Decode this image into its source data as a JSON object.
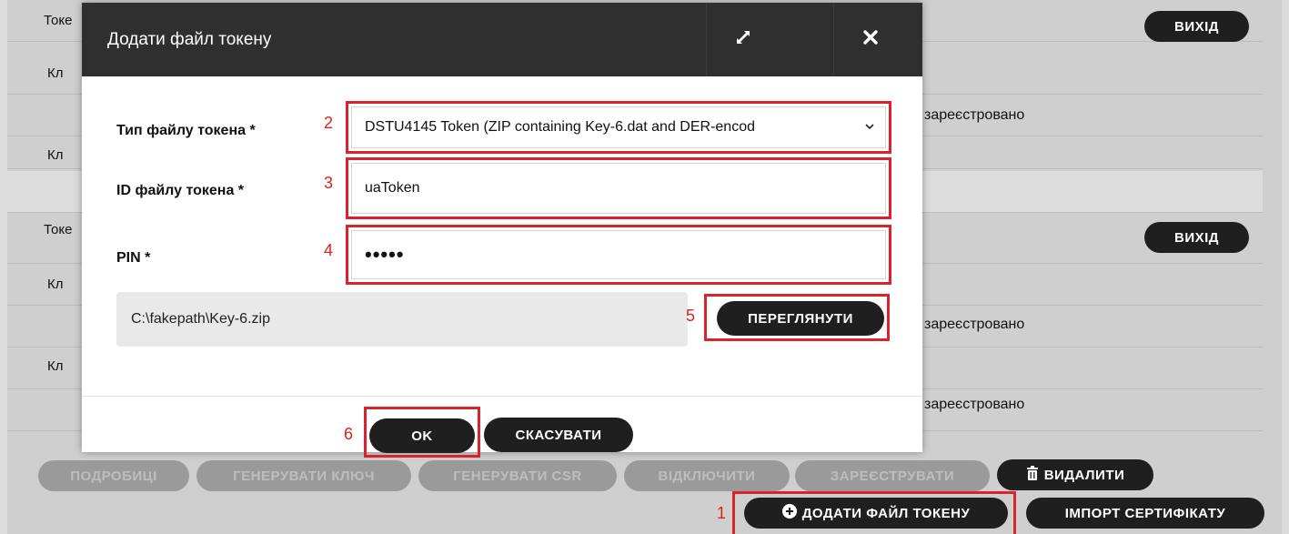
{
  "background": {
    "rows": [
      {
        "label": "Токе",
        "top": 0
      },
      {
        "label": "Кл",
        "top": 0
      },
      {
        "label": "",
        "top": 0
      },
      {
        "label": "Кл",
        "top": 0
      }
    ],
    "labels": [
      "Токе",
      "Кл",
      "Кл",
      "Токе",
      "Кл",
      "Кл"
    ],
    "status_text": "зареєстровано",
    "exit_label": "ВИХІД",
    "actions": {
      "details": "ПОДРОБИЦІ",
      "generate_key": "ГЕНЕРУВАТИ КЛЮЧ",
      "generate_csr": "ГЕНЕРУВАТИ CSR",
      "disconnect": "ВІДКЛЮЧИТИ",
      "register": "ЗАРЕЄСТРУВАТИ",
      "delete": "ВИДАЛИТИ"
    },
    "add_token_file": "ДОДАТИ ФАЙЛ ТОКЕНУ",
    "import_certificate": "ІМПОРТ СЕРТИФІКАТУ"
  },
  "dialog": {
    "title": "Додати файл токену",
    "token_type": {
      "label": "Тип файлу токена *",
      "value": "DSTU4145 Token (ZIP containing Key-6.dat and DER-encod"
    },
    "token_id": {
      "label": "ID файлу токена *",
      "value": "uaToken"
    },
    "pin": {
      "label": "PIN *",
      "value": "•••••"
    },
    "file_path": "C:\\fakepath\\Key-6.zip",
    "browse_label": "ПЕРЕГЛЯНУТИ",
    "ok_label": "OK",
    "cancel_label": "СКАСУВАТИ"
  },
  "annotations": [
    "1",
    "2",
    "3",
    "4",
    "5",
    "6"
  ],
  "colors": {
    "annotation_red": "#d9232d",
    "header_dark": "#2f2f2f",
    "button_dark": "#1f1f1f"
  }
}
